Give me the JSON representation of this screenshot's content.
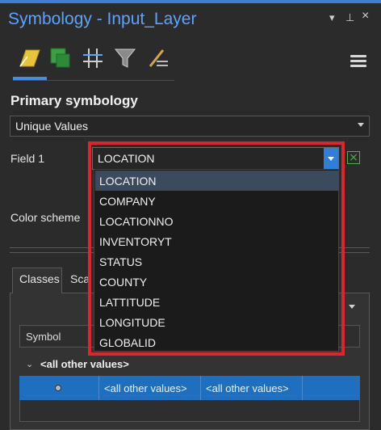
{
  "window": {
    "title": "Symbology - Input_Layer",
    "controls": {
      "menu": "▾",
      "pin": "⊥",
      "close": "×"
    }
  },
  "tools": [
    "primary-symbology-icon",
    "vary-symbology-icon",
    "symbol-layer-drawing-icon",
    "symbol-display-filter-icon",
    "label-icon"
  ],
  "primary": {
    "heading": "Primary symbology",
    "renderer": "Unique Values",
    "field1_label": "Field 1",
    "field1_value": "LOCATION",
    "color_scheme_label": "Color scheme"
  },
  "dropdown": {
    "options": [
      "LOCATION",
      "COMPANY",
      "LOCATIONNO",
      "INVENTORYT",
      "STATUS",
      "COUNTY",
      "LATTITUDE",
      "LONGITUDE",
      "GLOBALID"
    ],
    "selected_index": 0
  },
  "tabs": {
    "classes": "Classes",
    "scales": "Sca"
  },
  "grid": {
    "header_symbol": "Symbol",
    "group_row": "<all other values>",
    "row_value": "<all other values>",
    "row_label": "<all other values>"
  },
  "colors": {
    "accent": "#3f8fe6",
    "highlight": "#e0242a",
    "selection": "#1e6fbf"
  }
}
